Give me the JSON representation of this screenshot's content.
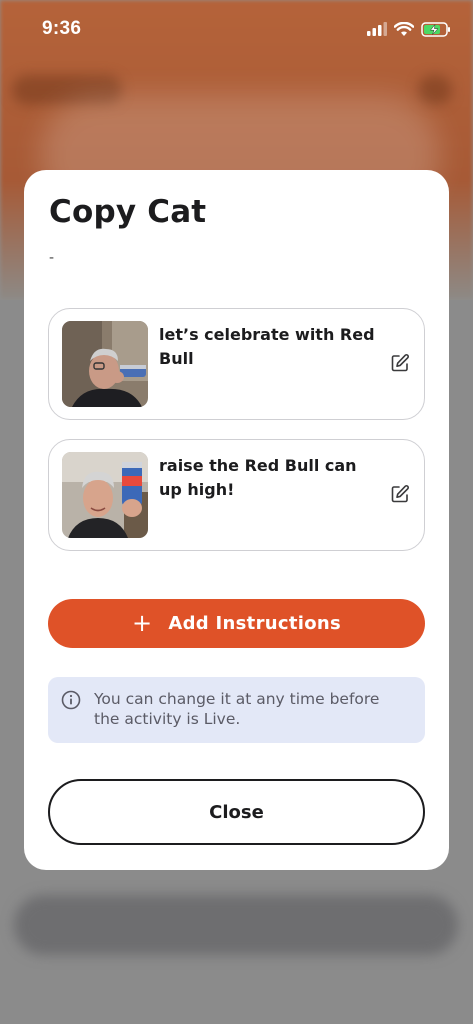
{
  "status_bar": {
    "time": "9:36"
  },
  "modal": {
    "title": "Copy Cat",
    "subtitle": "-",
    "items": [
      {
        "text": "let’s celebrate with Red Bull",
        "thumbnail": "man drinking from can"
      },
      {
        "text": "raise the Red Bull can up high!",
        "thumbnail": "man holding can up"
      }
    ],
    "add_button_label": "Add Instructions",
    "info_text": "You can change it at any time before the activity is Live.",
    "close_button_label": "Close"
  },
  "colors": {
    "accent": "#df5228",
    "info_background": "#e3e8f7",
    "text": "#1c1c1e"
  }
}
